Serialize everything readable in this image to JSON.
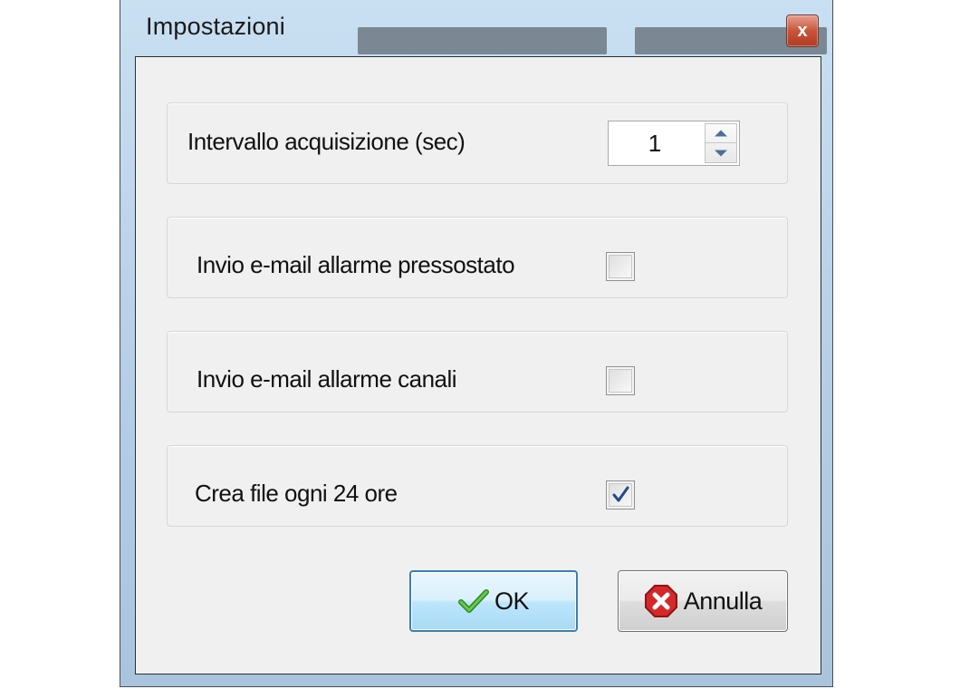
{
  "window": {
    "title": "Impostazioni",
    "close_label": "x"
  },
  "settings": {
    "interval": {
      "label": "Intervallo acquisizione (sec)",
      "value": "1"
    },
    "email_pressure_alarm": {
      "label": "Invio e-mail allarme pressostato",
      "checked": false
    },
    "email_channel_alarm": {
      "label": "Invio e-mail allarme canali",
      "checked": false
    },
    "file_every_24h": {
      "label": "Crea file ogni 24 ore",
      "checked": true
    }
  },
  "buttons": {
    "ok_label": "OK",
    "cancel_label": "Annulla"
  },
  "icons": {
    "ok": "check-icon",
    "cancel": "error-stop-icon",
    "close": "close-icon"
  },
  "colors": {
    "title_bar": "#b4cde6",
    "client_bg": "#f0f0f0",
    "ok_border": "#3c7fb1",
    "check_green": "#3aa12c",
    "cancel_red": "#d62828",
    "checkmark_blue": "#27488a"
  }
}
